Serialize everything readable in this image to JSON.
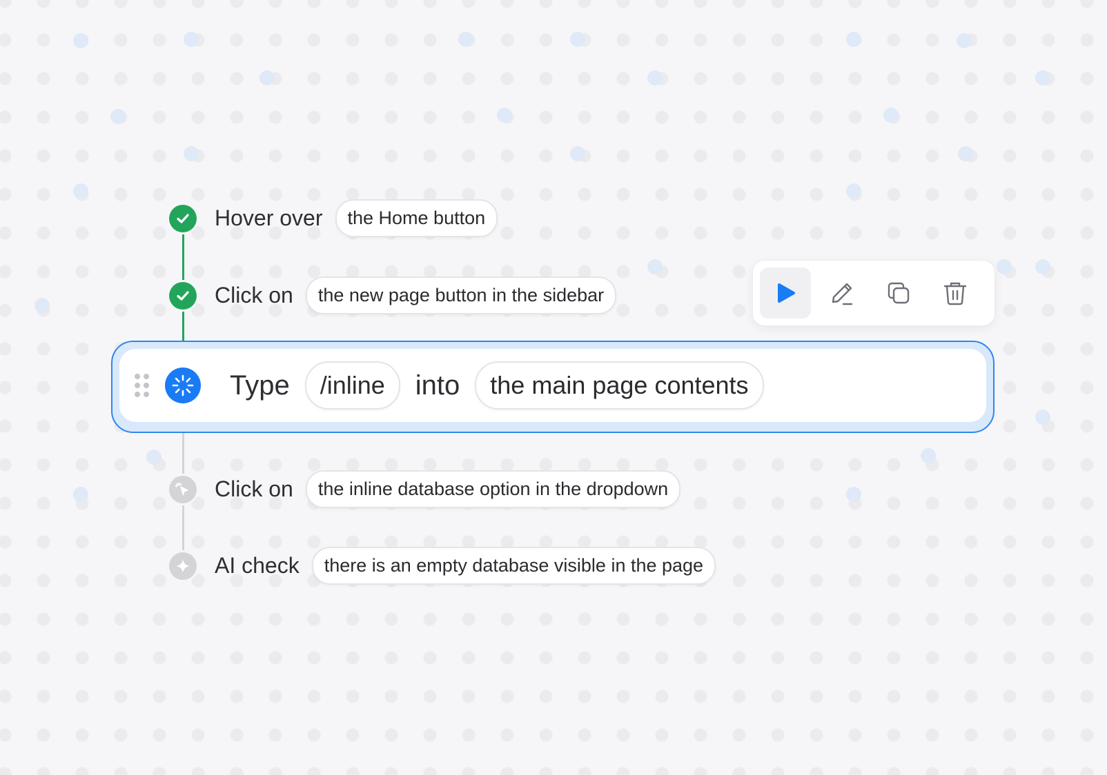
{
  "steps": [
    {
      "status": "completed",
      "verb": "Hover over",
      "target": "the Home button"
    },
    {
      "status": "completed",
      "verb": "Click on",
      "target": "the new page button in the sidebar"
    },
    {
      "status": "running",
      "verb": "Type",
      "value": "/inline",
      "connector": "into",
      "target": "the main page contents"
    },
    {
      "status": "pending",
      "verb": "Click on",
      "target": "the inline database option in the dropdown"
    },
    {
      "status": "pending",
      "verb": "AI check",
      "target": "there is an empty database visible in the page"
    }
  ],
  "toolbar": {
    "actions": [
      "play-icon",
      "edit-icon",
      "duplicate-icon",
      "delete-icon"
    ]
  },
  "icons": {
    "completed": "checkmark-icon",
    "running": "loading-spinner-icon",
    "pending_click": "cursor-click-icon",
    "pending_ai": "sparkle-icon",
    "drag": "drag-handle-icon"
  },
  "colors": {
    "success": "#22a55b",
    "active": "#1a7cf5",
    "pending": "#d3d3d8",
    "background": "#f6f6f8"
  }
}
